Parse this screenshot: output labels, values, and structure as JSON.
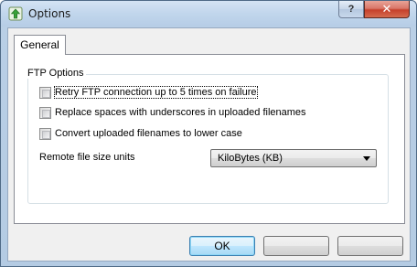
{
  "window": {
    "title": "Options",
    "help_label": "?",
    "close_label": "✕"
  },
  "tabs": [
    {
      "label": "General",
      "selected": true
    }
  ],
  "ftp_options": {
    "group_label": "FTP Options",
    "checkboxes": [
      {
        "label": "Retry FTP connection up to 5 times on failure",
        "checked": false
      },
      {
        "label": "Replace spaces with underscores in uploaded filenames",
        "checked": false
      },
      {
        "label": "Convert uploaded filenames to lower case",
        "checked": false
      }
    ],
    "size_units_label": "Remote file size units",
    "size_units_value": "KiloBytes (KB)"
  },
  "footer": {
    "ok_label": "OK",
    "button2_label": "",
    "button3_label": ""
  }
}
